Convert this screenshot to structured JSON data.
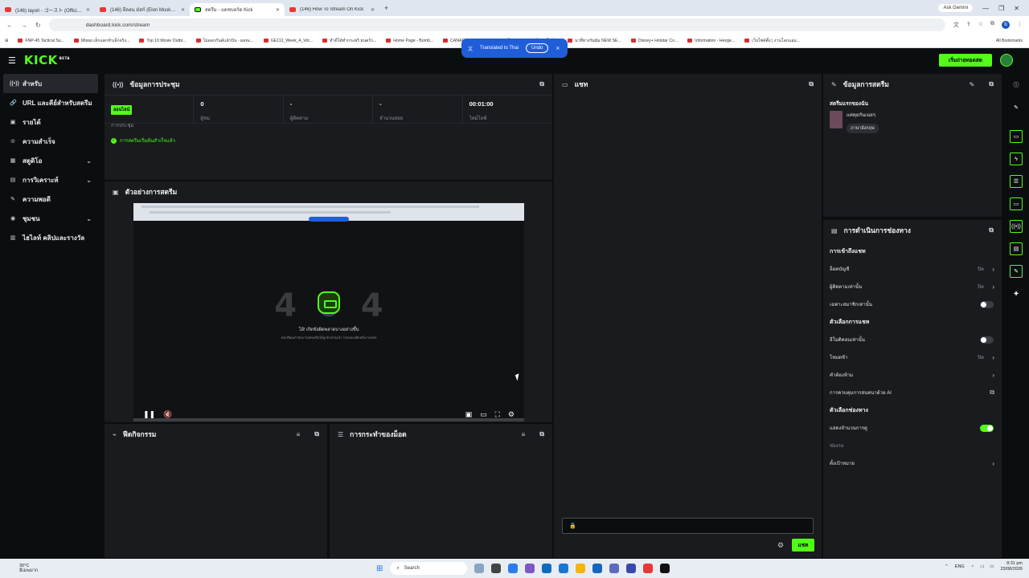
{
  "browser": {
    "tabs": [
      {
        "title": "(146) tayori - ゴースト (Official Vi"
      },
      {
        "title": "(146) อีลอน มัสก์ (Elon Musk) จะ"
      },
      {
        "title": "สตรีม - แดชบอร์ด Kick"
      },
      {
        "title": "(146) How To Stream On Kick"
      }
    ],
    "new_tab": "+",
    "ask_gemini": "Ask Gemini",
    "url": "dashboard.kick.com/stream",
    "profile_initial": "b",
    "bookmarks": [
      "FNP-45 Tactical Su...",
      "Misao เล็กแตกหัวเล็กจริง...",
      "Top 10 Movie Outbr...",
      "ไม่ออกกันต์แล้วบิน - ผลทะ...",
      "GE112_Week_4_Vot...",
      "ทำดีได้ทำกระพริ ยนตร์ร...",
      "Home Page - Bomb...",
      "CANAPIYA RESIDE...",
      "ไม่ทอดหมอบัญชี ออนไลน์...",
      "นาที่ทางรัมมัม NEW SE...",
      "Disney+ Hotstar Co...",
      "Information - Hexge...",
      "เว็บไซต์ตั้ง | งานโลกแอม..."
    ],
    "all_bookmarks": "All Bookmarks",
    "translate": {
      "text": "Translated to Thai",
      "undo": "Undo"
    }
  },
  "header": {
    "logo": "KICK",
    "logo_badge": "BETA",
    "go_live": "เริ่มถ่ายทอดสด"
  },
  "sidebar": {
    "items": [
      {
        "label": "สำหรับ",
        "icon": "broadcast-icon"
      },
      {
        "label": "URL และคีย์สำหรับสตรีม",
        "icon": "link-icon"
      },
      {
        "label": "รายได้",
        "icon": "wallet-icon"
      },
      {
        "label": "ความสำเร็จ",
        "icon": "trophy-icon"
      },
      {
        "label": "สตูดิโอ",
        "icon": "studio-icon"
      },
      {
        "label": "การวิเคราะห์",
        "icon": "analytics-icon"
      },
      {
        "label": "ความพอดี",
        "icon": "wrench-icon"
      },
      {
        "label": "ชุมชน",
        "icon": "community-icon"
      },
      {
        "label": "ไฮไลท์ คลิปและรางวัล",
        "icon": "clips-icon"
      }
    ]
  },
  "session": {
    "title": "ข้อมูลการประชุม",
    "badge": "ออนไลน์",
    "stats": [
      {
        "value": "",
        "label": "การประชุม"
      },
      {
        "value": "0",
        "label": "ผู้ชม"
      },
      {
        "value": "-",
        "label": "ผู้ติดตาม"
      },
      {
        "value": "-",
        "label": "จำนวนย่อย"
      },
      {
        "value": "00:01:00",
        "label": "ไทม์ไลฟ์"
      }
    ],
    "note": "การสตรีมเริ่มต้นสำเร็จแล้ว"
  },
  "preview": {
    "title": "ตัวอย่างการสตรีม",
    "error_code": "404",
    "message": "โอ้! เกิดข้อผิดพลาดบางอย่างขึ้น",
    "sub": "หน้าที่คุณกำลังหาไม่พบหรือได้ถูกย้ายไปแล้ว โปรดลองอีกครั้งภายหลัง"
  },
  "activity": {
    "title": "ฟีดกิจกรรม"
  },
  "mod_actions": {
    "title": "การกระทำของม็อด"
  },
  "chat": {
    "title": "แชท",
    "send": "แชท",
    "input_placeholder": ""
  },
  "stream_info": {
    "title": "ข้อมูลการสตรีม",
    "section": "สตรีมแรกของฉัน",
    "category": "แค่คุยกันเฉยๆ",
    "language_tag": "ภาษาอังกฤษ"
  },
  "channel": {
    "title": "การดำเนินการช่องทาง",
    "chat_access_title": "การเข้าถึงแชท",
    "chat_access": [
      {
        "label": "ล็อคบัญชี",
        "value": "ปิด"
      },
      {
        "label": "ผู้ติดตามเท่านั้น",
        "value": "ปิด"
      },
      {
        "label": "เฉพาะสมาชิกเท่านั้น",
        "toggle": false
      }
    ],
    "chat_options_title": "ตัวเลือกการแชท",
    "chat_options": [
      {
        "label": "อีโมติคอนเท่านั้น",
        "toggle": false
      },
      {
        "label": "โหมดช้า",
        "value": "ปิด"
      },
      {
        "label": "คำต้องห้าม"
      },
      {
        "label": "การควบคุมการสนทนาด้วย AI"
      }
    ],
    "channel_options_title": "ตัวเลือกช่องทาง",
    "channel_options": [
      {
        "label": "แสดงจำนวนการดู",
        "toggle": true
      },
      {
        "label": "ช่องรอ"
      },
      {
        "label": "ตั้งเป้าหมาย"
      }
    ]
  },
  "taskbar": {
    "weather_temp": "30°C",
    "weather_desc": "มีเมฆมาก",
    "search": "Search",
    "lang": "ENG",
    "time": "8:31 pm",
    "date": "23/08/2026"
  },
  "colors": {
    "accent": "#53fc18",
    "panel": "#191b1f",
    "bg": "#0b0e0f"
  }
}
